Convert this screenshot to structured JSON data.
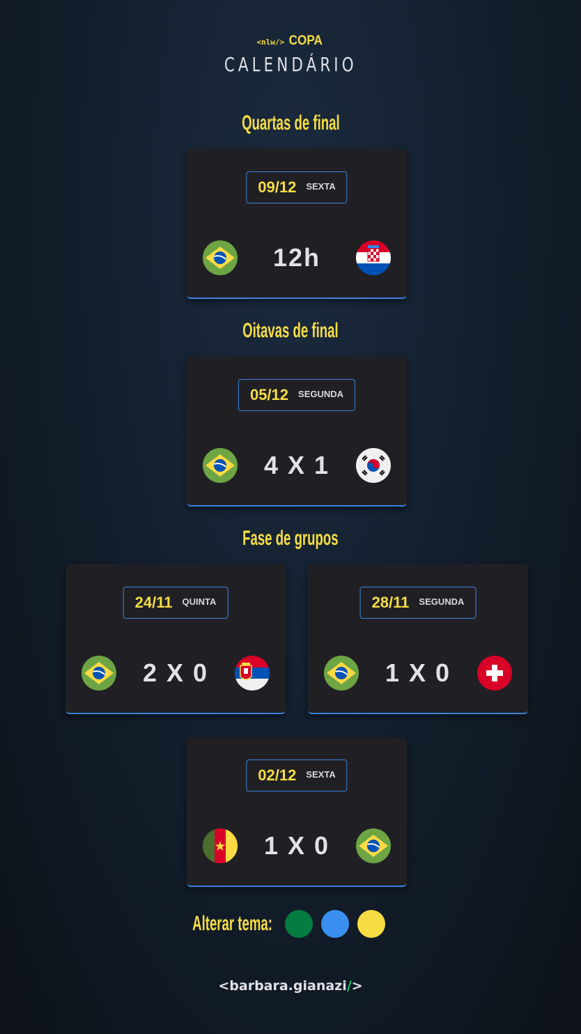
{
  "header": {
    "logo_prefix": "<nlw/>",
    "logo_word": "COPA",
    "title": "CALENDÁRIO"
  },
  "sections": {
    "quarters": {
      "title": "Quartas de final",
      "match": {
        "date": "09/12",
        "weekday": "SEXTA",
        "score": "12h",
        "home_flag": "brazil-flag",
        "away_flag": "croatia-flag"
      }
    },
    "round16": {
      "title": "Oitavas de final",
      "match": {
        "date": "05/12",
        "weekday": "SEGUNDA",
        "score": "4 X 1",
        "home_flag": "brazil-flag",
        "away_flag": "south-korea-flag"
      }
    },
    "groups": {
      "title": "Fase de grupos",
      "matches": [
        {
          "date": "24/11",
          "weekday": "QUINTA",
          "score": "2 X 0",
          "home_flag": "brazil-flag",
          "away_flag": "serbia-flag"
        },
        {
          "date": "28/11",
          "weekday": "SEGUNDA",
          "score": "1 X 0",
          "home_flag": "brazil-flag",
          "away_flag": "switzerland-flag"
        },
        {
          "date": "02/12",
          "weekday": "SEXTA",
          "score": "1 X 0",
          "home_flag": "cameroon-flag",
          "away_flag": "brazil-flag"
        }
      ]
    }
  },
  "theme": {
    "label": "Alterar tema:",
    "colors": [
      "#047c3f",
      "#3b8ff0",
      "#f7dd43"
    ]
  },
  "footer": {
    "open": "<",
    "name": "barbara.gianazi",
    "slash": "/",
    "close": ">"
  }
}
